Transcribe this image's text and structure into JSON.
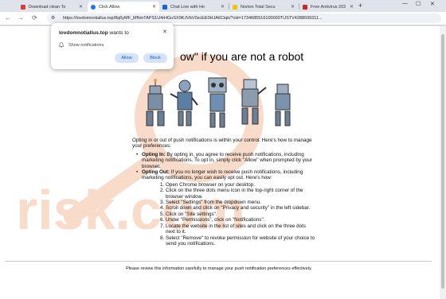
{
  "tabs": [
    {
      "label": "Download clean To",
      "favicon_color": "#e53935",
      "active": false
    },
    {
      "label": "Click Allow",
      "favicon_color": "#1a73e8",
      "active": true
    },
    {
      "label": "Chat Live with Ho",
      "favicon_color": "#1e63d6",
      "active": false
    },
    {
      "label": "Norton Total Secu",
      "favicon_color": "#f4c20d",
      "active": false
    },
    {
      "label": "Free Antivirus 202",
      "favicon_color": "#c62828",
      "active": false
    }
  ],
  "icons": {
    "back": "←",
    "forward": "→",
    "reload": "⟳",
    "tune": "⚙",
    "close": "✕",
    "new_tab": "+",
    "bell": "🔔",
    "minimize": "—",
    "maximize": "☐",
    "window_close": "✕"
  },
  "address_bar": {
    "url": "https://lovdomnotiallus.top/8q6yMF_MNmTAPS1U4rHGuSX9KJVbV0zcEE0HJA6Ciqk/?cid=1734685516100000TUSTV4288939311..."
  },
  "popup": {
    "site": "lovdomnotiallus.top",
    "wants_to": " wants to",
    "permission": "Show notifications",
    "allow_label": "Allow",
    "block_label": "Block"
  },
  "page": {
    "headline": "ow\" if you are not a robot",
    "intro": "Opting in or out of push notifications is within your control. Here's how to manage your preferences:",
    "opt_in_label": "Opting In:",
    "opt_in_text": " By opting in, you agree to receive push notifications, including marketing notifications. To opt in, simply click \"Allow\" when prompted by your browser.",
    "opt_out_label": "Opting Out:",
    "opt_out_text": " If you no longer wish to receive push notifications, including marketing notifications, you can easily opt out. Here's how:",
    "steps": [
      "Open Chrome browser on your desktop.",
      "Click on the three dots menu icon in the top-right corner of the browser window.",
      "Select \"Settings\" from the dropdown menu.",
      "Scroll down and click on \"Privacy and security\" in the left sidebar.",
      "Click on \"Site settings\".",
      "Under \"Permissions\", click on \"Notifications\".",
      "Locate the website in the list of sites and click on the three dots next to it.",
      "Select \"Remove\" to revoke permission for website of your choice to send you notifications."
    ],
    "footer": "Please review this information carefully to manage your push notification preferences effectively."
  },
  "watermark": {
    "text": "risk.com",
    "color": "#f6d3bd"
  }
}
